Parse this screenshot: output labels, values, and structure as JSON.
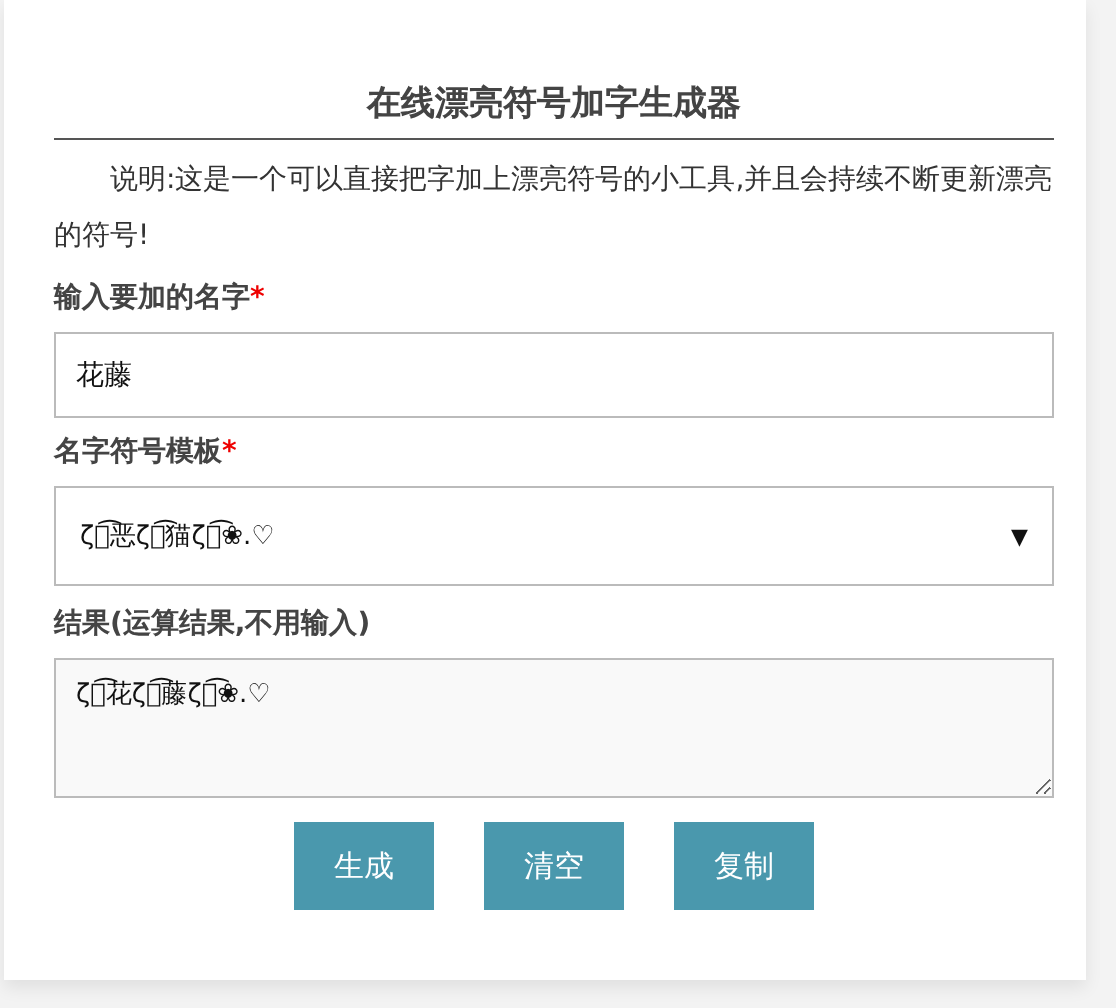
{
  "title": "在线漂亮符号加字生成器",
  "description": "说明:这是一个可以直接把字加上漂亮符号的小工具,并且会持续不断更新漂亮的符号!",
  "name_field": {
    "label": "输入要加的名字",
    "required_mark": "*",
    "value": "花藤"
  },
  "template_field": {
    "label": "名字符号模板",
    "required_mark": "*",
    "value": "ζั͡恶ζั͡猫ζั͡❀.♡",
    "arrow": "▼"
  },
  "result_field": {
    "label": "结果(运算结果,不用输入)",
    "value": "ζั͡花ζั͡藤ζั͡❀.♡"
  },
  "buttons": [
    "生成",
    "清空",
    "复制"
  ]
}
